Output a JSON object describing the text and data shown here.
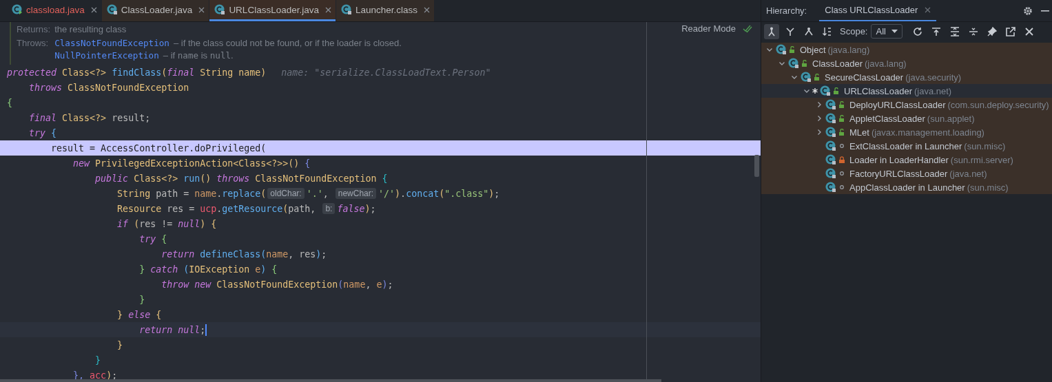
{
  "editor": {
    "tabs": [
      {
        "label": "classload.java",
        "selected": false,
        "library": false,
        "has_errors": true
      },
      {
        "label": "ClassLoader.java",
        "selected": false,
        "library": true,
        "has_errors": false
      },
      {
        "label": "URLClassLoader.java",
        "selected": true,
        "library": true,
        "has_errors": false
      },
      {
        "label": "Launcher.class",
        "selected": false,
        "library": true,
        "has_errors": false
      }
    ],
    "doc": {
      "returns_label": "Returns:",
      "returns_text": "the resulting class",
      "throws_label": "Throws:",
      "throws": [
        {
          "exception": "ClassNotFoundException",
          "parts": [
            {
              "t": "– if the class could not be found, or if the loader is closed.",
              "code": false
            }
          ]
        },
        {
          "exception": "NullPointerException",
          "parts": [
            {
              "t": "– if ",
              "code": false
            },
            {
              "t": "name",
              "code": true
            },
            {
              "t": " is ",
              "code": false
            },
            {
              "t": "null",
              "code": true
            },
            {
              "t": ".",
              "code": false
            }
          ]
        }
      ]
    },
    "reader_mode": "Reader Mode",
    "lines": [
      {
        "highlight": false,
        "caret": false,
        "tokens": [
          {
            "text": "protected ",
            "kind": "kw"
          },
          {
            "text": "Class",
            "kind": "type"
          },
          {
            "text": "<?> ",
            "kind": "br3"
          },
          {
            "text": "findClass",
            "kind": "fn"
          },
          {
            "text": "(",
            "kind": "br3"
          },
          {
            "text": "final ",
            "kind": "kw"
          },
          {
            "text": "String name",
            "kind": "type"
          },
          {
            "text": ")",
            "kind": "br3"
          },
          {
            "text": "name: \"serialize.ClassLoadText.Person\"",
            "kind": "ghost"
          }
        ]
      },
      {
        "highlight": false,
        "caret": false,
        "tokens": [
          {
            "text": "    throws ",
            "kind": "kw"
          },
          {
            "text": "ClassNotFoundException",
            "kind": "type"
          }
        ]
      },
      {
        "highlight": false,
        "caret": false,
        "tokens": [
          {
            "text": "{",
            "kind": "br1"
          }
        ]
      },
      {
        "highlight": false,
        "caret": false,
        "tokens": [
          {
            "text": "    final ",
            "kind": "kw"
          },
          {
            "text": "Class",
            "kind": "type"
          },
          {
            "text": "<?>",
            "kind": "br3"
          },
          {
            "text": " result;",
            "kind": "plain"
          }
        ]
      },
      {
        "highlight": false,
        "caret": false,
        "tokens": [
          {
            "text": "    try ",
            "kind": "kw"
          },
          {
            "text": "{",
            "kind": "br2"
          }
        ]
      },
      {
        "highlight": true,
        "caret": false,
        "tokens": [
          {
            "text": "        result = AccessController.doPrivileged(",
            "kind": "plain"
          }
        ]
      },
      {
        "highlight": false,
        "caret": false,
        "tokens": [
          {
            "text": "            new ",
            "kind": "kw"
          },
          {
            "text": "PrivilegedExceptionAction<Class<?>>",
            "kind": "type"
          },
          {
            "text": "() ",
            "kind": "br3"
          },
          {
            "text": "{",
            "kind": "br4"
          }
        ]
      },
      {
        "highlight": false,
        "caret": false,
        "tokens": [
          {
            "text": "                public ",
            "kind": "kw"
          },
          {
            "text": "Class",
            "kind": "type"
          },
          {
            "text": "<?> ",
            "kind": "br3"
          },
          {
            "text": "run",
            "kind": "fn"
          },
          {
            "text": "() ",
            "kind": "br3"
          },
          {
            "text": "throws ",
            "kind": "kw"
          },
          {
            "text": "ClassNotFoundException ",
            "kind": "type"
          },
          {
            "text": "{",
            "kind": "br5"
          }
        ]
      },
      {
        "highlight": false,
        "caret": false,
        "tokens": [
          {
            "text": "                    String",
            "kind": "type"
          },
          {
            "text": " path = ",
            "kind": "plain"
          },
          {
            "text": "name",
            "kind": "param"
          },
          {
            "text": ".",
            "kind": "plain"
          },
          {
            "text": "replace",
            "kind": "fn"
          },
          {
            "text": "(",
            "kind": "br3"
          },
          {
            "text": "oldChar:",
            "kind": "hint"
          },
          {
            "text": "'.'",
            "kind": "str"
          },
          {
            "text": ", ",
            "kind": "plain"
          },
          {
            "text": "newChar:",
            "kind": "hint"
          },
          {
            "text": "'/'",
            "kind": "str"
          },
          {
            "text": ")",
            "kind": "br3"
          },
          {
            "text": ".",
            "kind": "plain"
          },
          {
            "text": "concat",
            "kind": "fn"
          },
          {
            "text": "(",
            "kind": "br3"
          },
          {
            "text": "\".class\"",
            "kind": "str"
          },
          {
            "text": ")",
            "kind": "br3"
          },
          {
            "text": ";",
            "kind": "plain"
          }
        ]
      },
      {
        "highlight": false,
        "caret": false,
        "tokens": [
          {
            "text": "                    Resource",
            "kind": "type"
          },
          {
            "text": " res = ",
            "kind": "plain"
          },
          {
            "text": "ucp",
            "kind": "field"
          },
          {
            "text": ".",
            "kind": "plain"
          },
          {
            "text": "getResource",
            "kind": "fn"
          },
          {
            "text": "(",
            "kind": "br3"
          },
          {
            "text": "path, ",
            "kind": "plain"
          },
          {
            "text": "b:",
            "kind": "hint"
          },
          {
            "text": "false",
            "kind": "kw"
          },
          {
            "text": ")",
            "kind": "br3"
          },
          {
            "text": ";",
            "kind": "plain"
          }
        ]
      },
      {
        "highlight": false,
        "caret": false,
        "tokens": [
          {
            "text": "                    if ",
            "kind": "kw"
          },
          {
            "text": "(",
            "kind": "br3"
          },
          {
            "text": "res != ",
            "kind": "plain"
          },
          {
            "text": "null",
            "kind": "kw"
          },
          {
            "text": ") {",
            "kind": "br3"
          }
        ]
      },
      {
        "highlight": false,
        "caret": false,
        "tokens": [
          {
            "text": "                        try ",
            "kind": "kw"
          },
          {
            "text": "{",
            "kind": "br1"
          }
        ]
      },
      {
        "highlight": false,
        "caret": false,
        "tokens": [
          {
            "text": "                            return ",
            "kind": "kw"
          },
          {
            "text": "defineClass",
            "kind": "fn"
          },
          {
            "text": "(",
            "kind": "br2"
          },
          {
            "text": "name",
            "kind": "param"
          },
          {
            "text": ", res",
            "kind": "plain"
          },
          {
            "text": ")",
            "kind": "br2"
          },
          {
            "text": ";",
            "kind": "plain"
          }
        ]
      },
      {
        "highlight": false,
        "caret": false,
        "tokens": [
          {
            "text": "                        } ",
            "kind": "br1"
          },
          {
            "text": "catch ",
            "kind": "kw"
          },
          {
            "text": "(",
            "kind": "br2"
          },
          {
            "text": "IOException ",
            "kind": "type"
          },
          {
            "text": "e",
            "kind": "param"
          },
          {
            "text": ") ",
            "kind": "br2"
          },
          {
            "text": "{",
            "kind": "br1"
          }
        ]
      },
      {
        "highlight": false,
        "caret": false,
        "tokens": [
          {
            "text": "                            throw new ",
            "kind": "kw"
          },
          {
            "text": "ClassNotFoundException",
            "kind": "type"
          },
          {
            "text": "(",
            "kind": "br4"
          },
          {
            "text": "name",
            "kind": "param"
          },
          {
            "text": ", ",
            "kind": "plain"
          },
          {
            "text": "e",
            "kind": "param"
          },
          {
            "text": ")",
            "kind": "br4"
          },
          {
            "text": ";",
            "kind": "plain"
          }
        ]
      },
      {
        "highlight": false,
        "caret": false,
        "tokens": [
          {
            "text": "                        }",
            "kind": "br1"
          }
        ]
      },
      {
        "highlight": false,
        "caret": false,
        "tokens": [
          {
            "text": "                    } ",
            "kind": "br3"
          },
          {
            "text": "else ",
            "kind": "kw"
          },
          {
            "text": "{",
            "kind": "br3"
          }
        ]
      },
      {
        "highlight": false,
        "caret": true,
        "tokens": [
          {
            "text": "                        return null",
            "kind": "kw"
          },
          {
            "text": ";",
            "kind": "plain"
          }
        ]
      },
      {
        "highlight": false,
        "caret": false,
        "tokens": [
          {
            "text": "                    }",
            "kind": "br3"
          }
        ]
      },
      {
        "highlight": false,
        "caret": false,
        "tokens": [
          {
            "text": "                }",
            "kind": "br5"
          }
        ]
      },
      {
        "highlight": false,
        "caret": false,
        "tokens": [
          {
            "text": "            }, ",
            "kind": "br4"
          },
          {
            "text": "acc",
            "kind": "field"
          },
          {
            "text": ")",
            "kind": "br3"
          },
          {
            "text": ";",
            "kind": "plain"
          }
        ]
      }
    ]
  },
  "hierarchy": {
    "label": "Hierarchy:",
    "tab": {
      "label": "Class URLClassLoader",
      "selected": true
    },
    "view_modes": [
      {
        "kind": "type",
        "selected": true
      },
      {
        "kind": "supertypes",
        "selected": false
      },
      {
        "kind": "subtypes",
        "selected": false
      }
    ],
    "scope_label": "Scope:",
    "scope_value": "All",
    "tree": [
      {
        "name": "Object",
        "package": "(java.lang)",
        "expanded": true,
        "kind": "public",
        "current": false,
        "selected": false,
        "children": [
          {
            "name": "ClassLoader",
            "package": "(java.lang)",
            "expanded": true,
            "kind": "public",
            "current": false,
            "selected": false,
            "children": [
              {
                "name": "SecureClassLoader",
                "package": "(java.security)",
                "expanded": true,
                "kind": "public",
                "current": false,
                "selected": false,
                "children": [
                  {
                    "name": "URLClassLoader",
                    "package": "(java.net)",
                    "expanded": true,
                    "kind": "public",
                    "current": true,
                    "selected": true,
                    "children": [
                      {
                        "name": "DeployURLClassLoader",
                        "package": "(com.sun.deploy.security)",
                        "expanded": false,
                        "kind": "public",
                        "current": false,
                        "selected": false
                      },
                      {
                        "name": "AppletClassLoader",
                        "package": "(sun.applet)",
                        "expanded": false,
                        "kind": "public",
                        "current": false,
                        "selected": false
                      },
                      {
                        "name": "MLet",
                        "package": "(javax.management.loading)",
                        "expanded": false,
                        "kind": "public",
                        "current": false,
                        "selected": false
                      },
                      {
                        "name": "ExtClassLoader in Launcher",
                        "package": "(sun.misc)",
                        "kind": "package",
                        "current": false,
                        "selected": false
                      },
                      {
                        "name": "Loader in LoaderHandler",
                        "package": "(sun.rmi.server)",
                        "kind": "private",
                        "current": false,
                        "selected": false
                      },
                      {
                        "name": "FactoryURLClassLoader",
                        "package": "(java.net)",
                        "kind": "package",
                        "current": false,
                        "selected": false
                      },
                      {
                        "name": "AppClassLoader in Launcher",
                        "package": "(sun.misc)",
                        "kind": "package",
                        "current": false,
                        "selected": false
                      }
                    ]
                  }
                ]
              }
            ]
          }
        ]
      }
    ]
  }
}
